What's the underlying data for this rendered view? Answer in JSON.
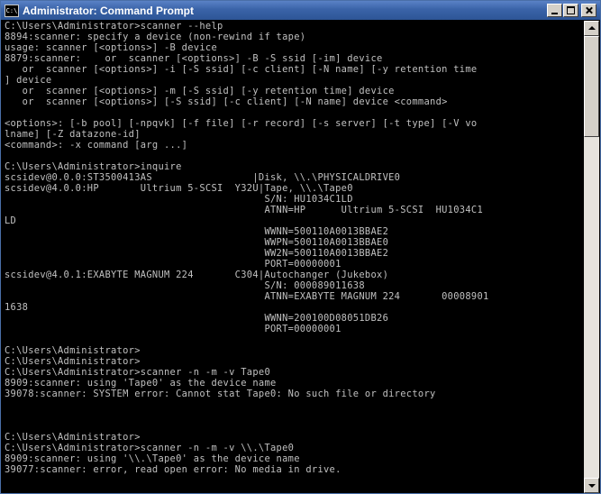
{
  "window": {
    "title": "Administrator: Command Prompt",
    "icon_text": "C:\\"
  },
  "controls": {
    "minimize": "minimize-icon",
    "maximize": "maximize-icon",
    "close": "close-icon"
  },
  "console": {
    "lines": [
      "C:\\Users\\Administrator>scanner --help",
      "8894:scanner: specify a device (non-rewind if tape)",
      "usage: scanner [<options>] -B device",
      "8879:scanner:    or  scanner [<options>] -B -S ssid [-im] device",
      "   or  scanner [<options>] -i [-S ssid] [-c client] [-N name] [-y retention time",
      "] device",
      "   or  scanner [<options>] -m [-S ssid] [-y retention time] device",
      "   or  scanner [<options>] [-S ssid] [-c client] [-N name] device <command>",
      "",
      "<options>: [-b pool] [-npqvk] [-f file] [-r record] [-s server] [-t type] [-V vo",
      "lname] [-Z datazone-id]",
      "<command>: -x command [arg ...]",
      "",
      "C:\\Users\\Administrator>inquire",
      "scsidev@0.0.0:ST3500413AS                 |Disk, \\\\.\\PHYSICALDRIVE0",
      "scsidev@4.0.0:HP       Ultrium 5-SCSI  Y32U|Tape, \\\\.\\Tape0",
      "                                            S/N: HU1034C1LD",
      "                                            ATNN=HP      Ultrium 5-SCSI  HU1034C1",
      "LD",
      "                                            WWNN=500110A0013BBAE2",
      "                                            WWPN=500110A0013BBAE0",
      "                                            WW2N=500110A0013BBAE2",
      "                                            PORT=00000001",
      "scsidev@4.0.1:EXABYTE MAGNUM 224       C304|Autochanger (Jukebox)",
      "                                            S/N: 000089011638",
      "                                            ATNN=EXABYTE MAGNUM 224       00008901",
      "1638",
      "                                            WWNN=200100D08051DB26",
      "                                            PORT=00000001",
      "",
      "C:\\Users\\Administrator>",
      "C:\\Users\\Administrator>",
      "C:\\Users\\Administrator>scanner -n -m -v Tape0",
      "8909:scanner: using 'Tape0' as the device name",
      "39078:scanner: SYSTEM error: Cannot stat Tape0: No such file or directory",
      "",
      "",
      "",
      "C:\\Users\\Administrator>",
      "C:\\Users\\Administrator>scanner -n -m -v \\\\.\\Tape0",
      "8909:scanner: using '\\\\.\\Tape0' as the device name",
      "39077:scanner: error, read open error: No media in drive."
    ]
  },
  "scrollbar": {
    "up": "scroll-up-arrow-icon",
    "down": "scroll-down-arrow-icon"
  }
}
